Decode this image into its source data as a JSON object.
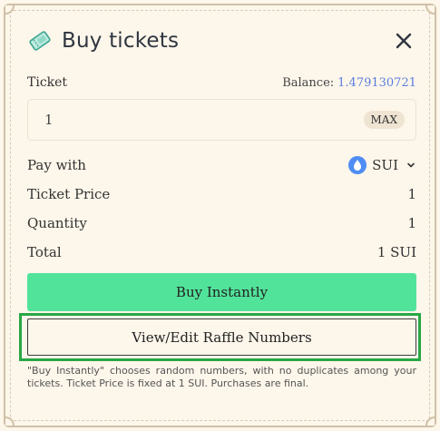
{
  "header": {
    "title": "Buy tickets",
    "icon": "ticket-icon",
    "close_icon": "close-icon"
  },
  "ticket_row": {
    "label": "Ticket",
    "balance_label": "Balance:",
    "balance_value": "1.479130721"
  },
  "quantity_input": {
    "value": "1",
    "max_label": "MAX"
  },
  "pay_with": {
    "label": "Pay with",
    "token": "SUI",
    "token_icon": "sui-icon"
  },
  "summary": [
    {
      "label": "Ticket Price",
      "value": "1"
    },
    {
      "label": "Quantity",
      "value": "1"
    },
    {
      "label": "Total",
      "value": "1 SUI"
    }
  ],
  "buttons": {
    "buy_instantly": "Buy Instantly",
    "view_edit": "View/Edit Raffle Numbers"
  },
  "note": "\"Buy Instantly\" chooses random numbers, with no duplicates among your tickets. Ticket Price is fixed at 1 SUI. Purchases are final.",
  "colors": {
    "background": "#fdf6ea",
    "accent_green": "#52e39a",
    "highlight_green": "#28a745",
    "balance_blue": "#5a7ee0",
    "sui_blue": "#4f8df5"
  }
}
